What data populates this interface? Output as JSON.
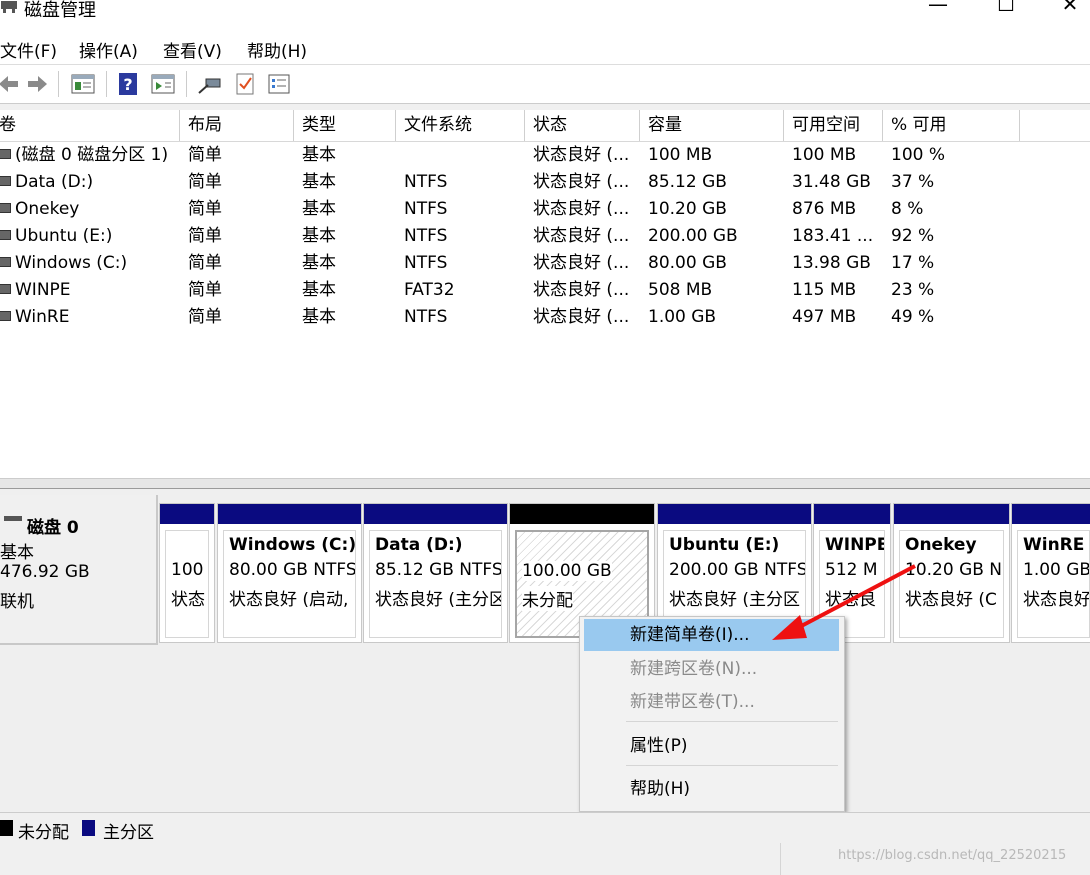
{
  "window": {
    "title": "磁盘管理",
    "minimize_icon": "minimize-icon",
    "maximize_icon": "maximize-icon",
    "close_icon": "close-icon"
  },
  "menu": [
    "文件(F)",
    "操作(A)",
    "查看(V)",
    "帮助(H)"
  ],
  "toolbar": [
    "back-icon",
    "forward-icon",
    "console-tree-icon",
    "help-icon",
    "action-pane-icon",
    "connect-icon",
    "check-icon",
    "properties-icon"
  ],
  "volume_table": {
    "columns": [
      "卷",
      "布局",
      "类型",
      "文件系统",
      "状态",
      "容量",
      "可用空间",
      "% 可用"
    ],
    "rows": [
      [
        "(磁盘 0 磁盘分区 1)",
        "简单",
        "基本",
        "",
        "状态良好 (...",
        "100 MB",
        "100 MB",
        "100 %"
      ],
      [
        "Data (D:)",
        "简单",
        "基本",
        "NTFS",
        "状态良好 (...",
        "85.12 GB",
        "31.48 GB",
        "37 %"
      ],
      [
        "Onekey",
        "简单",
        "基本",
        "NTFS",
        "状态良好 (...",
        "10.20 GB",
        "876 MB",
        "8 %"
      ],
      [
        "Ubuntu (E:)",
        "简单",
        "基本",
        "NTFS",
        "状态良好 (...",
        "200.00 GB",
        "183.41 ...",
        "92 %"
      ],
      [
        "Windows (C:)",
        "简单",
        "基本",
        "NTFS",
        "状态良好 (...",
        "80.00 GB",
        "13.98 GB",
        "17 %"
      ],
      [
        "WINPE",
        "简单",
        "基本",
        "FAT32",
        "状态良好 (...",
        "508 MB",
        "115 MB",
        "23 %"
      ],
      [
        "WinRE",
        "简单",
        "基本",
        "NTFS",
        "状态良好 (...",
        "1.00 GB",
        "497 MB",
        "49 %"
      ]
    ]
  },
  "disk": {
    "name": "磁盘 0",
    "type": "基本",
    "size": "476.92 GB",
    "status": "联机",
    "partitions": [
      {
        "name": "",
        "size": "100",
        "status": "状态"
      },
      {
        "name": "Windows (C:)",
        "size": "80.00 GB NTFS",
        "status": "状态良好 (启动,"
      },
      {
        "name": "Data (D:)",
        "size": "85.12 GB NTFS",
        "status": "状态良好 (主分区"
      },
      {
        "name": "",
        "size": "100.00 GB",
        "status": "未分配"
      },
      {
        "name": "Ubuntu (E:)",
        "size": "200.00 GB NTFS",
        "status": "状态良好 (主分区"
      },
      {
        "name": "WINPE",
        "size": "512 M",
        "status": "状态良"
      },
      {
        "name": "Onekey",
        "size": "10.20 GB N",
        "status": "状态良好 (C"
      },
      {
        "name": "WinRE",
        "size": "1.00 GB",
        "status": "状态良好"
      }
    ]
  },
  "context_menu": {
    "items": [
      "新建简单卷(I)...",
      "新建跨区卷(N)...",
      "新建带区卷(T)...",
      "属性(P)",
      "帮助(H)"
    ]
  },
  "legend": {
    "unallocated": "未分配",
    "primary": "主分区",
    "unallocated_color": "#000000",
    "primary_color": "#0a0a80"
  },
  "watermark": "https://blog.csdn.net/qq_22520215"
}
